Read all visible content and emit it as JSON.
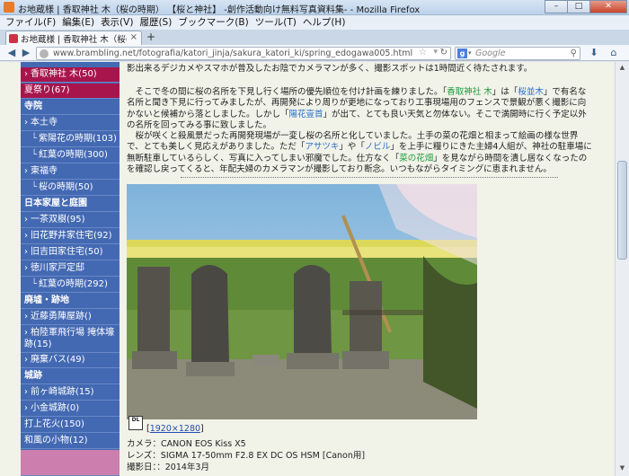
{
  "window": {
    "title": "お地蔵様 | 香取神社 木（桜の時期） 【桜と神社】 -創作活動向け無料写真資料集- - Mozilla Firefox",
    "minimize": "–",
    "maximize": "□",
    "close": "✕"
  },
  "menu": [
    "ファイル(F)",
    "編集(E)",
    "表示(V)",
    "履歴(S)",
    "ブックマーク(B)",
    "ツール(T)",
    "ヘルプ(H)"
  ],
  "tab": {
    "title": "お地蔵様 | 香取神社 木（桜の時期）...",
    "close": "×",
    "new_tab": "+"
  },
  "nav": {
    "back": "◀",
    "forward": "▶",
    "url": "www.brambling.net/fotografia/katori_jinja/sakura_katori_ki/spring_edogawa005.html",
    "search_placeholder": "Google",
    "search_engine_icon": "g-icon",
    "download_icon": "download-arrow-icon",
    "home_icon": "home-icon"
  },
  "sidebar": {
    "items": [
      {
        "label": "香取神社 木(50)",
        "style": "hl",
        "arrow": true
      },
      {
        "label": "夏祭り(67)",
        "style": "hl",
        "arrow": false
      },
      {
        "label": "寺院",
        "style": "cat",
        "arrow": false
      },
      {
        "label": "本土寺",
        "style": "",
        "arrow": true
      },
      {
        "label": "紫陽花の時期(103)",
        "style": "",
        "arrow": false,
        "prefix": "└"
      },
      {
        "label": "紅葉の時期(300)",
        "style": "",
        "arrow": false,
        "prefix": "└"
      },
      {
        "label": "東福寺",
        "style": "",
        "arrow": true
      },
      {
        "label": "桜の時期(50)",
        "style": "",
        "arrow": false,
        "prefix": "└"
      },
      {
        "label": "日本家屋と庭園",
        "style": "cat",
        "arrow": false
      },
      {
        "label": "一茶双樹(95)",
        "style": "",
        "arrow": true
      },
      {
        "label": "旧花野井家住宅(92)",
        "style": "",
        "arrow": true
      },
      {
        "label": "旧吉田家住宅(50)",
        "style": "",
        "arrow": true
      },
      {
        "label": "徳川家戸定邸",
        "style": "",
        "arrow": true
      },
      {
        "label": "紅葉の時期(292)",
        "style": "",
        "arrow": false,
        "prefix": "└"
      },
      {
        "label": "廃墟・跡地",
        "style": "cat",
        "arrow": false
      },
      {
        "label": "近藤勇陣屋跡()",
        "style": "",
        "arrow": true
      },
      {
        "label": "柏陸軍飛行場 掩体壕跡(15)",
        "style": "wrap",
        "arrow": true
      },
      {
        "label": "廃棄バス(49)",
        "style": "",
        "arrow": true
      },
      {
        "label": "城跡",
        "style": "cat",
        "arrow": false
      },
      {
        "label": "前ヶ崎城跡(15)",
        "style": "",
        "arrow": true
      },
      {
        "label": "小金城跡(0)",
        "style": "",
        "arrow": true
      },
      {
        "label": "打上花火(150)",
        "style": "",
        "arrow": false
      },
      {
        "label": "和風の小物(12)",
        "style": "",
        "arrow": false
      },
      {
        "label": "",
        "style": "pink",
        "arrow": false
      }
    ]
  },
  "article": {
    "p0": "影出来るデジカメやスマホが普及したお陰でカメラマンが多く、撮影スポットは1時間近く待たされます。",
    "p1_a": "　そこで冬の間に桜の名所を下見し行く場所の優先順位を付け計画を練りました。「",
    "p1_l1": "香取神社 木",
    "p1_b": "」は「",
    "p1_l2": "桜並木",
    "p1_c": "」で有名な名所と聞き下見に行ってみましたが、再開発により周りが更地になっており工事現場用のフェンスで景観が悪く撮影に向かないと候補から落としました。しかし「",
    "p1_l3": "陽花壹首",
    "p1_d": "」が出て、とても良い天気と勿体ない。そこで満開時に行く予定以外の名所を回ってみる事に致しました。",
    "p2_a": "　桜が咲くと殺風景だった再開発現場が一変し桜の名所と化していました。土手の菜の花畑と相まって絵画の様な世界で、とても美しく見応えがありました。ただ「",
    "p2_l1": "アサツキ",
    "p2_b": "」や「",
    "p2_l2": "ノビル",
    "p2_c": "」を上手に糧りにきた主婦4人組が、神社の駐車場に無断駐車しているらしく、写真に入ってしまい邪魔でした。仕方なく「",
    "p2_l3": "菜の花畑",
    "p2_d": "」を見ながら時間を潰し居なくなったのを確認し戻ってくると、年配夫婦のカメラマンが撮影しており断念。いつもながらタイミングに恵まれません。"
  },
  "photo_meta": {
    "dl_icon_text": "DL",
    "resolution_link": "1920×1280",
    "camera": "カメラ：CANON EOS Kiss X5",
    "lens": "レンズ：SIGMA 17-50mm F2.8 EX DC OS HSM [Canon用]",
    "date": "撮影日：：2014年3月"
  }
}
